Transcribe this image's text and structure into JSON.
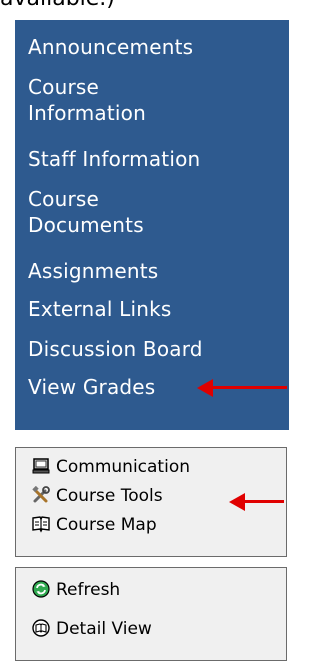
{
  "top_text": "available.)",
  "nav": {
    "items": [
      {
        "label": "Announcements"
      },
      {
        "label": "Course Information"
      },
      {
        "label": "Staff Information"
      },
      {
        "label": "Course Documents"
      },
      {
        "label": "Assignments"
      },
      {
        "label": "External Links"
      },
      {
        "label": "Discussion Board"
      },
      {
        "label": "View Grades"
      }
    ]
  },
  "tools_box": {
    "items": [
      {
        "label": "Communication",
        "icon": "communication-icon"
      },
      {
        "label": "Course Tools",
        "icon": "course-tools-icon"
      },
      {
        "label": "Course Map",
        "icon": "course-map-icon"
      }
    ]
  },
  "view_box": {
    "items": [
      {
        "label": "Refresh",
        "icon": "refresh-icon"
      },
      {
        "label": "Detail View",
        "icon": "detail-view-icon"
      }
    ]
  },
  "colors": {
    "nav_background": "#2e5a8f",
    "nav_text": "#ffffff",
    "annotation_arrow": "#e00000"
  }
}
